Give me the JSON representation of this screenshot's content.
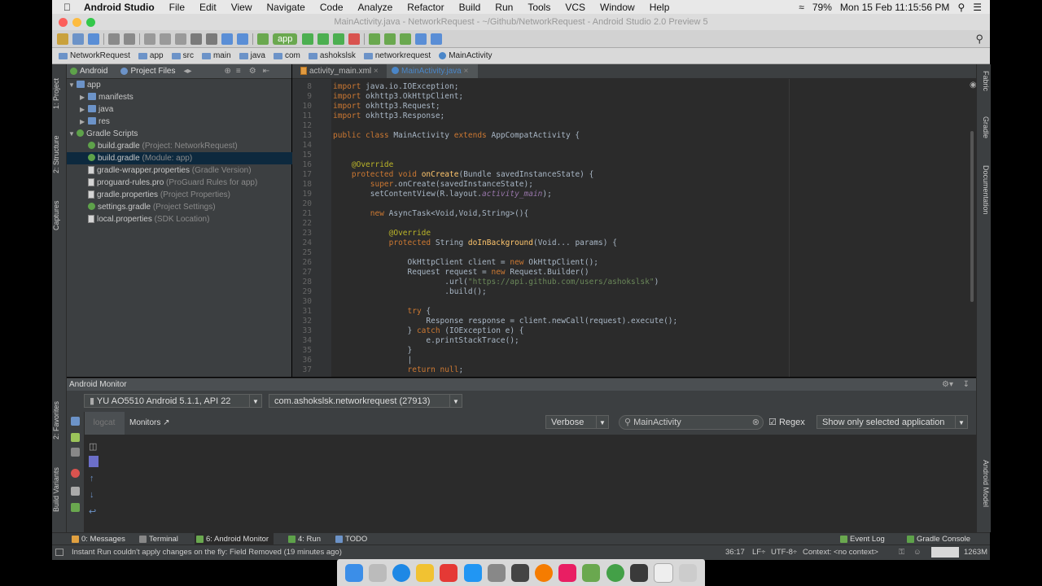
{
  "menubar": {
    "app_name": "Android Studio",
    "items": [
      "File",
      "Edit",
      "View",
      "Navigate",
      "Code",
      "Analyze",
      "Refactor",
      "Build",
      "Run",
      "Tools",
      "VCS",
      "Window",
      "Help"
    ],
    "battery": "79%",
    "clock": "Mon 15 Feb  11:15:56 PM"
  },
  "window": {
    "title": "MainActivity.java - NetworkRequest - ~/Github/NetworkRequest - Android Studio 2.0 Preview 5"
  },
  "toolbar": {
    "run_config": "app"
  },
  "breadcrumb": [
    "NetworkRequest",
    "app",
    "src",
    "main",
    "java",
    "com",
    "ashokslsk",
    "networkrequest",
    "MainActivity"
  ],
  "project_panel": {
    "view_mode": "Android",
    "alt_view": "Project Files",
    "tree": [
      {
        "label": "app",
        "hint": "",
        "type": "folder",
        "expanded": true,
        "selected": false
      },
      {
        "label": "manifests",
        "hint": "",
        "type": "folder",
        "expanded": false,
        "selected": false
      },
      {
        "label": "java",
        "hint": "",
        "type": "folder",
        "expanded": false,
        "selected": false
      },
      {
        "label": "res",
        "hint": "",
        "type": "folder",
        "expanded": false,
        "selected": false
      },
      {
        "label": "Gradle Scripts",
        "hint": "",
        "type": "gradle",
        "expanded": true,
        "selected": false
      },
      {
        "label": "build.gradle",
        "hint": "(Project: NetworkRequest)",
        "type": "gradle",
        "expanded": false,
        "selected": false
      },
      {
        "label": "build.gradle",
        "hint": "(Module: app)",
        "type": "gradle",
        "expanded": false,
        "selected": true
      },
      {
        "label": "gradle-wrapper.properties",
        "hint": "(Gradle Version)",
        "type": "props",
        "expanded": false,
        "selected": false
      },
      {
        "label": "proguard-rules.pro",
        "hint": "(ProGuard Rules for app)",
        "type": "props",
        "expanded": false,
        "selected": false
      },
      {
        "label": "gradle.properties",
        "hint": "(Project Properties)",
        "type": "props",
        "expanded": false,
        "selected": false
      },
      {
        "label": "settings.gradle",
        "hint": "(Project Settings)",
        "type": "gradle",
        "expanded": false,
        "selected": false
      },
      {
        "label": "local.properties",
        "hint": "(SDK Location)",
        "type": "props",
        "expanded": false,
        "selected": false
      }
    ]
  },
  "editor": {
    "tabs": [
      "activity_main.xml",
      "MainActivity.java"
    ],
    "active_tab": 1,
    "lines": [
      {
        "n": "8",
        "html": "<span class='kw'>import</span> java.io.IOException;"
      },
      {
        "n": "9",
        "html": "<span class='kw'>import</span> okhttp3.OkHttpClient;"
      },
      {
        "n": "10",
        "html": "<span class='kw'>import</span> okhttp3.Request;"
      },
      {
        "n": "11",
        "html": "<span class='kw'>import</span> okhttp3.Response;"
      },
      {
        "n": "12",
        "html": ""
      },
      {
        "n": "13",
        "html": "<span class='kw'>public class</span> MainActivity <span class='kw'>extends</span> AppCompatActivity {"
      },
      {
        "n": "14",
        "html": ""
      },
      {
        "n": "15",
        "html": ""
      },
      {
        "n": "16",
        "html": "    <span class='an'>@Override</span>"
      },
      {
        "n": "17",
        "html": "    <span class='kw'>protected void</span> <span class='fn'>onCreate</span>(Bundle savedInstanceState) {"
      },
      {
        "n": "18",
        "html": "        <span class='kw'>super</span>.onCreate(savedInstanceState);"
      },
      {
        "n": "19",
        "html": "        setContentView(R.layout.<span class='it'>activity_main</span>);"
      },
      {
        "n": "20",
        "html": ""
      },
      {
        "n": "21",
        "html": "        <span class='kw'>new</span> AsyncTask&lt;Void,Void,String&gt;(){"
      },
      {
        "n": "22",
        "html": ""
      },
      {
        "n": "23",
        "html": "            <span class='an'>@Override</span>"
      },
      {
        "n": "24",
        "html": "            <span class='kw'>protected</span> String <span class='fn'>doInBackground</span>(Void... params) {"
      },
      {
        "n": "25",
        "html": ""
      },
      {
        "n": "26",
        "html": "                OkHttpClient client = <span class='kw'>new</span> OkHttpClient();"
      },
      {
        "n": "27",
        "html": "                Request request = <span class='kw'>new</span> Request.Builder()"
      },
      {
        "n": "28",
        "html": "                        .url(<span class='str'>\"https://api.github.com/users/ashokslsk\"</span>)"
      },
      {
        "n": "29",
        "html": "                        .build();"
      },
      {
        "n": "30",
        "html": ""
      },
      {
        "n": "31",
        "html": "                <span class='kw'>try</span> {"
      },
      {
        "n": "32",
        "html": "                    Response response = client.newCall(request).execute();"
      },
      {
        "n": "33",
        "html": "                } <span class='kw'>catch</span> (IOException e) {"
      },
      {
        "n": "34",
        "html": "                    e.printStackTrace();"
      },
      {
        "n": "35",
        "html": "                }"
      },
      {
        "n": "36",
        "html": "                |"
      },
      {
        "n": "37",
        "html": "                <span class='kw'>return null</span>;"
      }
    ]
  },
  "android_monitor": {
    "title": "Android Monitor",
    "device": "YU AO5510 Android 5.1.1, API 22",
    "process": "com.ashokslsk.networkrequest (27913)",
    "tab_logcat": "logcat",
    "tab_monitors": "Monitors",
    "log_level": "Verbose",
    "search_value": "MainActivity",
    "regex_label": "Regex",
    "filter": "Show only selected application"
  },
  "left_stripe": [
    "1: Project",
    "2: Structure",
    "Captures",
    "2: Favorites",
    "Build Variants"
  ],
  "right_stripe": [
    "Fabric",
    "Gradle",
    "Documentation",
    "Android Model"
  ],
  "bottom_tabs": [
    {
      "label": "0: Messages",
      "color": "#e0a040"
    },
    {
      "label": "Terminal",
      "color": "#888888"
    },
    {
      "label": "6: Android Monitor",
      "color": "#6aa84f"
    },
    {
      "label": "4: Run",
      "color": "#5ea24a"
    },
    {
      "label": "TODO",
      "color": "#6c93c8"
    }
  ],
  "bottom_right_tabs": [
    "Event Log",
    "Gradle Console"
  ],
  "status": {
    "message": "Instant Run couldn't apply changes on the fly: Field Removed (19 minutes ago)",
    "position": "36:17",
    "line_sep": "LF÷",
    "encoding": "UTF-8÷",
    "context": "Context: <no context>",
    "memory": "1263M"
  },
  "colors": {
    "accent_green": "#6aa84f",
    "selection": "#0d293e",
    "editor_bg": "#2b2b2b",
    "panel_bg": "#3c3f41"
  }
}
